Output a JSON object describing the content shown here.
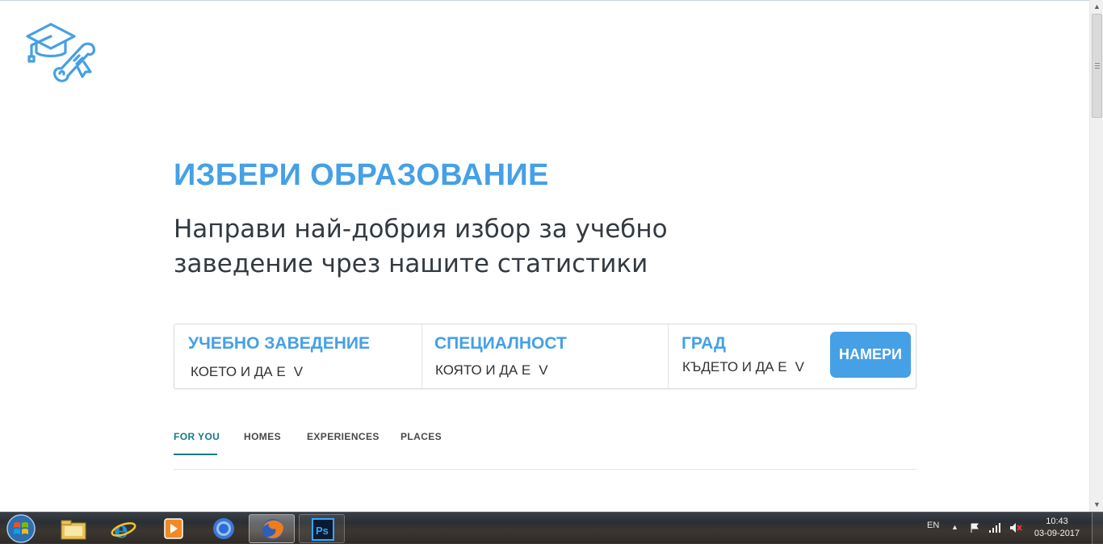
{
  "hero": {
    "title": "ИЗБЕРИ ОБРАЗОВАНИЕ",
    "subtitle": "Направи най-добрия избор за учебно заведение чрез нашите статистики"
  },
  "search": {
    "fields": [
      {
        "title": "УЧЕБНО ЗАВЕДЕНИЕ",
        "value": "КОЕТО И ДА Е",
        "arrow": "V"
      },
      {
        "title": "СПЕЦИАЛНОСТ",
        "value": "КОЯТО И ДА Е",
        "arrow": "V"
      },
      {
        "title": "ГРАД",
        "value": "КЪДЕТО И ДА Е",
        "arrow": "V"
      }
    ],
    "button_label": "НАМЕРИ"
  },
  "tabs": [
    {
      "label": "FOR YOU",
      "active": true
    },
    {
      "label": "HOMES",
      "active": false
    },
    {
      "label": "EXPERIENCES",
      "active": false
    },
    {
      "label": "PLACES",
      "active": false
    }
  ],
  "taskbar": {
    "apps": [
      "file-explorer",
      "internet-explorer",
      "media-player",
      "chrome",
      "firefox",
      "photoshop"
    ],
    "active_app": "firefox",
    "language": "EN",
    "time": "10:43",
    "date": "03-09-2017"
  },
  "colors": {
    "accent": "#45a0e6",
    "active_tab": "#157a82",
    "text": "#333a40"
  }
}
